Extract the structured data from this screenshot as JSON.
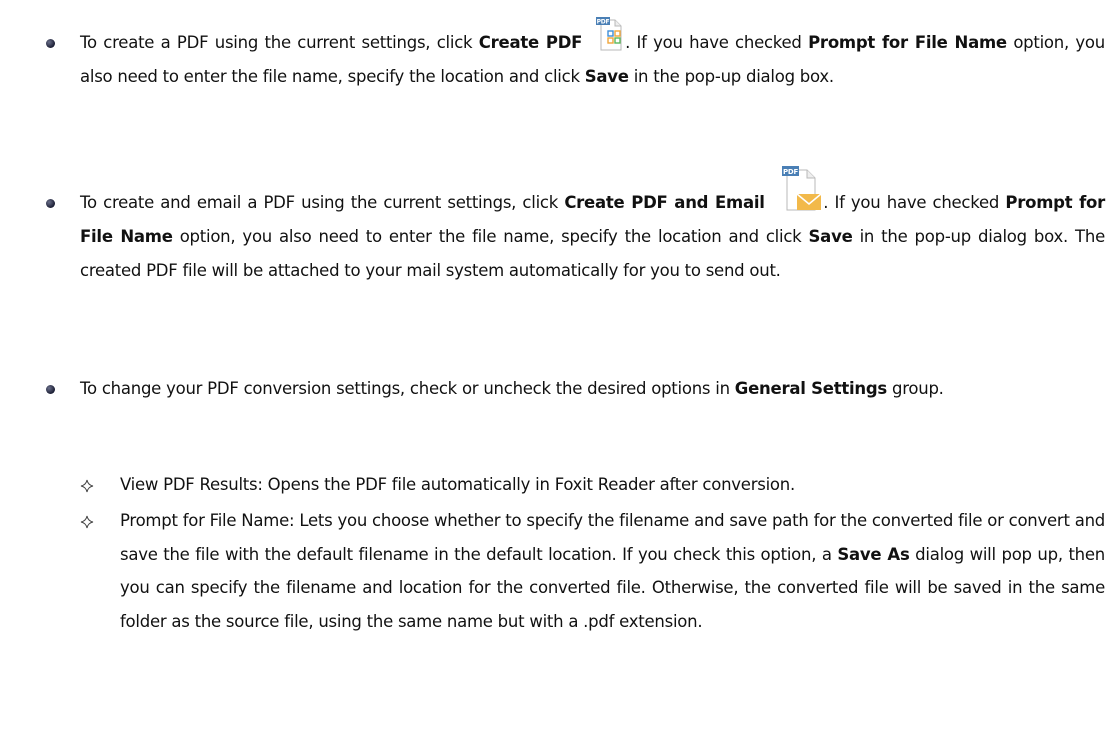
{
  "bullets": [
    {
      "parts": [
        "To create a PDF using the current settings, click ",
        "Create PDF",
        ". If you have checked ",
        "Prompt for File Name",
        " option, you also need to enter the file name, specify the location and click ",
        "Save",
        " in the pop-up dialog box."
      ]
    },
    {
      "parts": [
        "To create and email a PDF using the current settings, click ",
        "Create PDF and Email",
        ". If you have checked ",
        "Prompt for File Name",
        " option, you also need to enter the file name, specify the location and click ",
        "Save",
        " in the pop-up dialog box. The created PDF file will be attached to your mail system automatically for you to send out."
      ]
    },
    {
      "parts": [
        "To change your PDF conversion settings, check or uncheck the desired options in ",
        "General Settings",
        " group."
      ]
    }
  ],
  "sub_items": [
    {
      "text": "View PDF Results: Opens the PDF file automatically in Foxit Reader after conversion."
    },
    {
      "parts": [
        "Prompt for File Name: Lets you choose whether to specify the filename and save path for the converted file or convert and save the file with the default filename in the default location. If you check this option, a ",
        "Save As",
        " dialog will pop up, then you can specify the filename and location for the converted file. Otherwise, the converted file will be saved in the same folder as the source file, using the same name but with a .pdf extension."
      ]
    }
  ],
  "icons": {
    "create_pdf": "pdf-document-grid-icon",
    "create_pdf_email": "pdf-document-envelope-icon",
    "pdf_badge_text": "PDF",
    "bullet": "filled-circle-bullet",
    "sub_bullet": "diamond-outline-bullet"
  },
  "colors": {
    "text": "#111111",
    "pdf_badge": "#4a7fb5",
    "envelope": "#f2b94a",
    "grid_blue": "#3e8ed8",
    "grid_orange": "#f0a63a",
    "grid_green": "#5cb85c"
  }
}
